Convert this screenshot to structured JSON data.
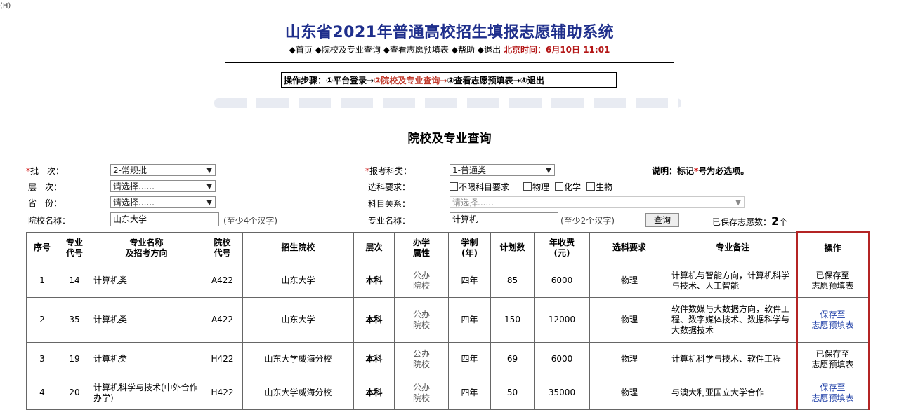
{
  "menubar": {
    "help": "(H)"
  },
  "header": {
    "title": "山东省2021年普通高校招生填报志愿辅助系统",
    "nav": [
      {
        "label": "首页"
      },
      {
        "label": "院校及专业查询"
      },
      {
        "label": "查看志愿预填表"
      },
      {
        "label": "帮助"
      },
      {
        "label": "退出"
      }
    ],
    "bullet": "◆",
    "time_label": "北京时间：6月10日 11:01"
  },
  "steps": {
    "prefix": "操作步骤：",
    "s1": "①平台登录→",
    "s2": "②院校及专业查询→",
    "s3": "③查看志愿预填表→",
    "s4": "④退出"
  },
  "section_title": "院校及专业查询",
  "form": {
    "batch_label": "批　次：",
    "batch_value": "2-常规批",
    "level_label": "层　次：",
    "level_value": "请选择......",
    "province_label": "省　份：",
    "province_value": "请选择......",
    "school_label": "院校名称：",
    "school_value": "山东大学",
    "school_hint": "(至少4个汉字)",
    "category_label": "报考科类：",
    "category_value": "1-普通类",
    "subject_req_label": "选科要求：",
    "subject_options": [
      "不限科目要求",
      "物理",
      "化学",
      "生物"
    ],
    "relation_label": "科目关系：",
    "relation_value": "请选择......",
    "major_label": "专业名称：",
    "major_value": "计算机",
    "major_hint": "(至少2个汉字)",
    "query_button": "查询",
    "note_prefix": "说明：标记",
    "note_star": "*",
    "note_suffix": "号为必选项。",
    "required_mark": "*",
    "saved_prefix": "已保存志愿数：",
    "saved_count": "2",
    "saved_suffix": "个"
  },
  "table": {
    "headers": [
      {
        "l1": "序号",
        "l2": ""
      },
      {
        "l1": "专业",
        "l2": "代号"
      },
      {
        "l1": "专业名称",
        "l2": "及招考方向"
      },
      {
        "l1": "院校",
        "l2": "代号"
      },
      {
        "l1": "招生院校",
        "l2": ""
      },
      {
        "l1": "层次",
        "l2": ""
      },
      {
        "l1": "办学",
        "l2": "属性"
      },
      {
        "l1": "学制",
        "l2": "(年)"
      },
      {
        "l1": "计划数",
        "l2": ""
      },
      {
        "l1": "年收费",
        "l2": "(元)"
      },
      {
        "l1": "选科要求",
        "l2": ""
      },
      {
        "l1": "专业备注",
        "l2": ""
      },
      {
        "l1": "操作",
        "l2": ""
      }
    ],
    "rows": [
      {
        "no": "1",
        "code": "14",
        "major": "计算机类",
        "school_code": "A422",
        "school": "山东大学",
        "level": "本科",
        "attr1": "公办",
        "attr2": "院校",
        "years": "四年",
        "plan": "85",
        "fee": "6000",
        "subject": "物理",
        "remark": "计算机与智能方向，计算机科学与技术、人工智能",
        "op1": "已保存至",
        "op2": "志愿预填表",
        "op_link": false
      },
      {
        "no": "2",
        "code": "35",
        "major": "计算机类",
        "school_code": "A422",
        "school": "山东大学",
        "level": "本科",
        "attr1": "公办",
        "attr2": "院校",
        "years": "四年",
        "plan": "150",
        "fee": "12000",
        "subject": "物理",
        "remark": "软件数媒与大数据方向，软件工程、数字媒体技术、数据科学与大数据技术",
        "op1": "保存至",
        "op2": "志愿预填表",
        "op_link": true
      },
      {
        "no": "3",
        "code": "19",
        "major": "计算机类",
        "school_code": "H422",
        "school": "山东大学威海分校",
        "level": "本科",
        "attr1": "公办",
        "attr2": "院校",
        "years": "四年",
        "plan": "69",
        "fee": "6000",
        "subject": "物理",
        "remark": "计算机科学与技术、软件工程",
        "op1": "已保存至",
        "op2": "志愿预填表",
        "op_link": false
      },
      {
        "no": "4",
        "code": "20",
        "major": "计算机科学与技术(中外合作办学)",
        "school_code": "H422",
        "school": "山东大学威海分校",
        "level": "本科",
        "attr1": "公办",
        "attr2": "院校",
        "years": "四年",
        "plan": "50",
        "fee": "35000",
        "subject": "物理",
        "remark": "与澳大利亚国立大学合作",
        "op1": "保存至",
        "op2": "志愿预填表",
        "op_link": true
      }
    ]
  }
}
